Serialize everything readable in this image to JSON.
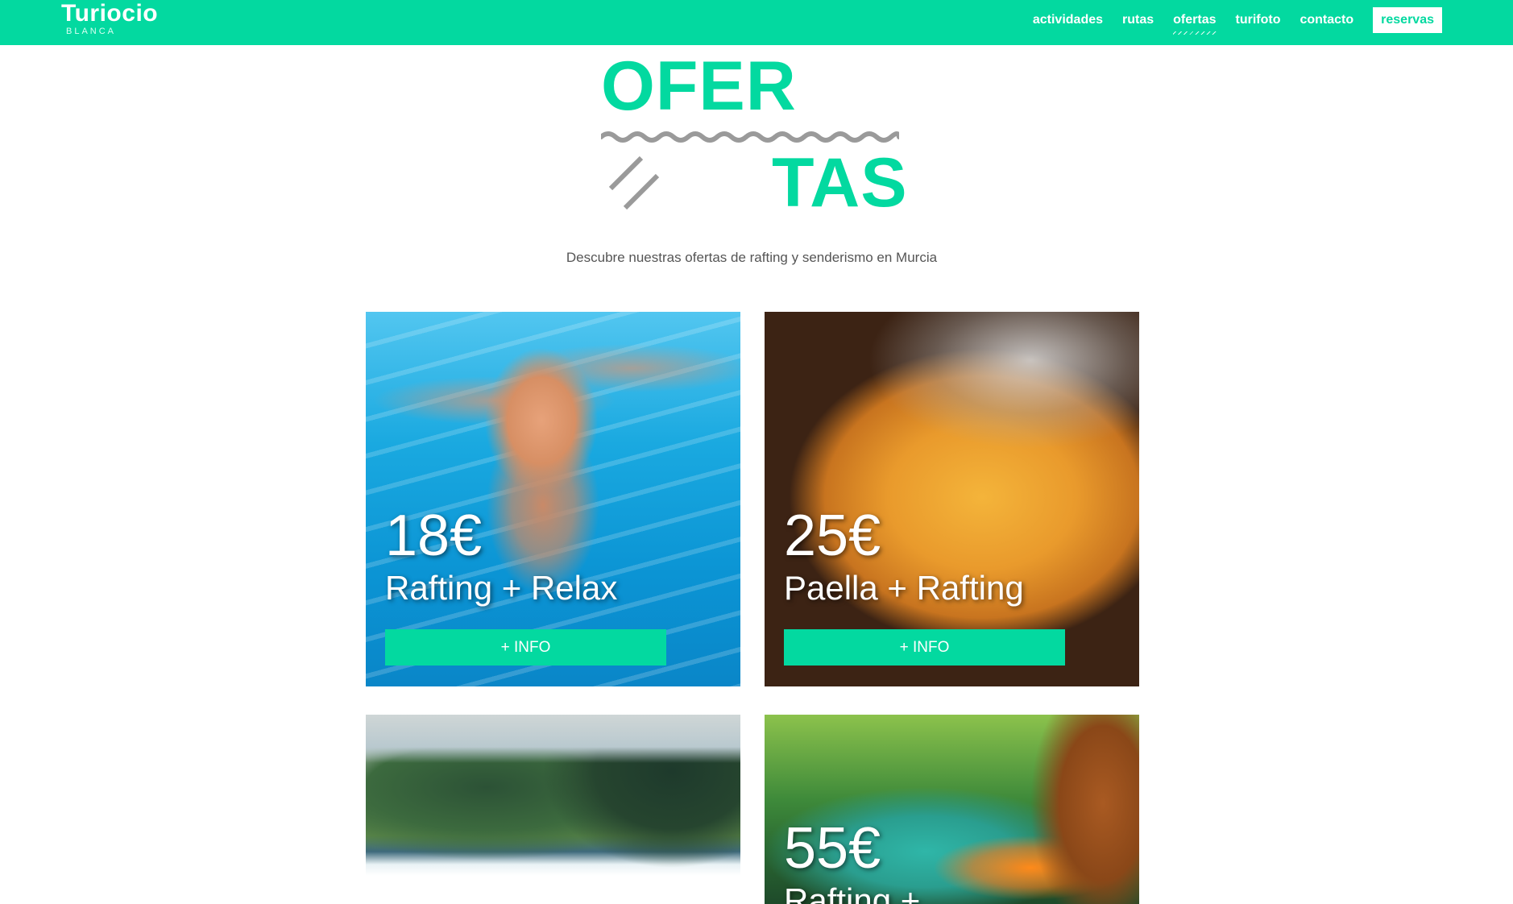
{
  "brand": {
    "name": "Turiocio",
    "subname": "BLANCA"
  },
  "nav": {
    "items": [
      {
        "label": "actividades",
        "active": false
      },
      {
        "label": "rutas",
        "active": false
      },
      {
        "label": "ofertas",
        "active": true
      },
      {
        "label": "turifoto",
        "active": false
      },
      {
        "label": "contacto",
        "active": false
      }
    ],
    "cta": "reservas"
  },
  "hero": {
    "title_top": "OFER",
    "title_bottom": "TAS",
    "subtitle": "Descubre nuestras ofertas de rafting y senderismo en Murcia"
  },
  "offers": [
    {
      "price": "18€",
      "name": "Rafting + Relax",
      "button": "+ INFO",
      "image": "child swimming underwater in pool"
    },
    {
      "price": "25€",
      "name": "Paella + Rafting",
      "button": "+ INFO",
      "image": "paella cooking over fire"
    },
    {
      "price": "",
      "name": "",
      "button": "",
      "image": "river weir with trees"
    },
    {
      "price": "55€",
      "name": "Rafting +",
      "button": "",
      "image": "rafting helmets in green canyon river"
    }
  ],
  "colors": {
    "accent": "#03d9a0",
    "text_muted": "#555555",
    "white": "#ffffff"
  }
}
